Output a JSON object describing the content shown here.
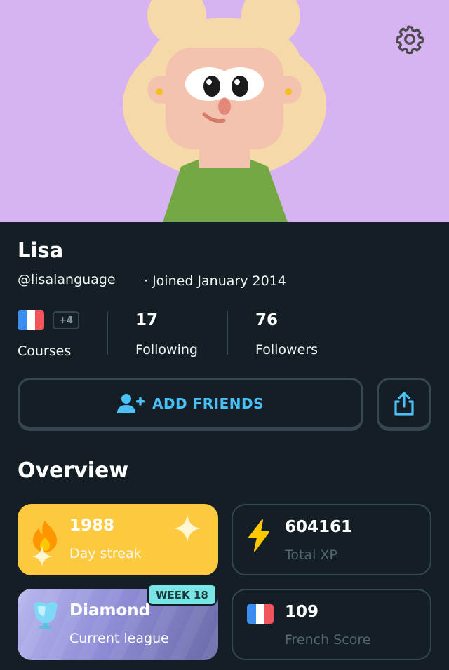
{
  "profile": {
    "name": "Lisa",
    "handle": "@lisalanguage",
    "joined": "· Joined January 2014",
    "avatar_bg": "#d7b3f2"
  },
  "stats": {
    "courses_label": "Courses",
    "courses_extra": "+4",
    "course_flag": "france-flag",
    "following_value": "17",
    "following_label": "Following",
    "followers_value": "76",
    "followers_label": "Followers"
  },
  "actions": {
    "add_friends_label": "ADD FRIENDS",
    "add_friends_icon": "add-user-icon",
    "share_icon": "share-icon",
    "settings_icon": "gear-icon"
  },
  "overview": {
    "title": "Overview",
    "cards": [
      {
        "value": "1988",
        "label": "Day streak",
        "icon": "flame-icon",
        "color": "#fdc93f"
      },
      {
        "value": "604161",
        "label": "Total XP",
        "icon": "lightning-icon",
        "color": "#ffc800"
      },
      {
        "value": "Diamond",
        "label": "Current league",
        "icon": "diamond-trophy-icon",
        "badge": "WEEK 18"
      },
      {
        "value": "109",
        "label": "French Score",
        "icon": "france-flag"
      }
    ]
  },
  "colors": {
    "background": "#131f24",
    "border": "#37464f",
    "accent_blue": "#49c0f8"
  }
}
